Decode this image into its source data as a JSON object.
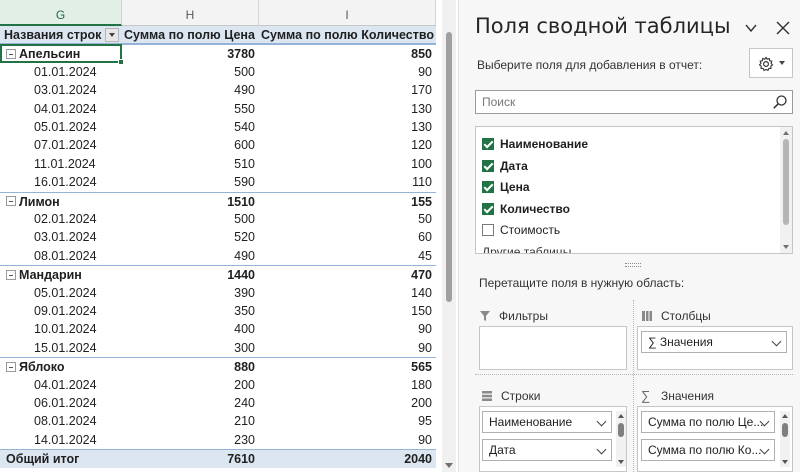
{
  "sheet": {
    "columns": [
      {
        "id": "G",
        "label": "G",
        "selected": true
      },
      {
        "id": "H",
        "label": "H",
        "selected": false
      },
      {
        "id": "I",
        "label": "I",
        "selected": false
      }
    ],
    "header": {
      "rows_label": "Названия строк",
      "price_label": "Сумма по полю Цена",
      "qty_label": "Сумма по полю Количество"
    },
    "groups": [
      {
        "name": "Апельсин",
        "price": "3780",
        "qty": "850",
        "rows": [
          {
            "date": "01.01.2024",
            "price": "500",
            "qty": "90"
          },
          {
            "date": "03.01.2024",
            "price": "490",
            "qty": "170"
          },
          {
            "date": "04.01.2024",
            "price": "550",
            "qty": "130"
          },
          {
            "date": "05.01.2024",
            "price": "540",
            "qty": "130"
          },
          {
            "date": "07.01.2024",
            "price": "600",
            "qty": "120"
          },
          {
            "date": "11.01.2024",
            "price": "510",
            "qty": "100"
          },
          {
            "date": "16.01.2024",
            "price": "590",
            "qty": "110"
          }
        ]
      },
      {
        "name": "Лимон",
        "price": "1510",
        "qty": "155",
        "rows": [
          {
            "date": "02.01.2024",
            "price": "500",
            "qty": "50"
          },
          {
            "date": "03.01.2024",
            "price": "520",
            "qty": "60"
          },
          {
            "date": "08.01.2024",
            "price": "490",
            "qty": "45"
          }
        ]
      },
      {
        "name": "Мандарин",
        "price": "1440",
        "qty": "470",
        "rows": [
          {
            "date": "05.01.2024",
            "price": "390",
            "qty": "140"
          },
          {
            "date": "09.01.2024",
            "price": "350",
            "qty": "150"
          },
          {
            "date": "10.01.2024",
            "price": "400",
            "qty": "90"
          },
          {
            "date": "15.01.2024",
            "price": "300",
            "qty": "90"
          }
        ]
      },
      {
        "name": "Яблоко",
        "price": "880",
        "qty": "565",
        "rows": [
          {
            "date": "04.01.2024",
            "price": "200",
            "qty": "180"
          },
          {
            "date": "06.01.2024",
            "price": "240",
            "qty": "200"
          },
          {
            "date": "08.01.2024",
            "price": "210",
            "qty": "95"
          },
          {
            "date": "14.01.2024",
            "price": "230",
            "qty": "90"
          }
        ]
      }
    ],
    "total": {
      "label": "Общий итог",
      "price": "7610",
      "qty": "2040"
    }
  },
  "pane": {
    "title": "Поля сводной таблицы",
    "choose_label": "Выберите поля для добавления в отчет:",
    "search_placeholder": "Поиск",
    "fields": [
      {
        "label": "Наименование",
        "checked": true
      },
      {
        "label": "Дата",
        "checked": true
      },
      {
        "label": "Цена",
        "checked": true
      },
      {
        "label": "Количество",
        "checked": true
      },
      {
        "label": "Стоимость",
        "checked": false
      }
    ],
    "other_tables": "Другие таблицы...",
    "drag_label": "Перетащите поля в нужную область:",
    "areas": {
      "filters": {
        "label": "Фильтры"
      },
      "columns": {
        "label": "Столбцы",
        "chips": [
          "∑ Значения"
        ]
      },
      "rows": {
        "label": "Строки",
        "chips": [
          "Наименование",
          "Дата"
        ]
      },
      "values": {
        "label": "Значения",
        "chips": [
          "Сумма по полю Це...",
          "Сумма по полю Ко..."
        ]
      }
    }
  },
  "colors": {
    "accent": "#217346",
    "pivot_header_bg": "#dce6f1",
    "pivot_border": "#95b3d7"
  }
}
